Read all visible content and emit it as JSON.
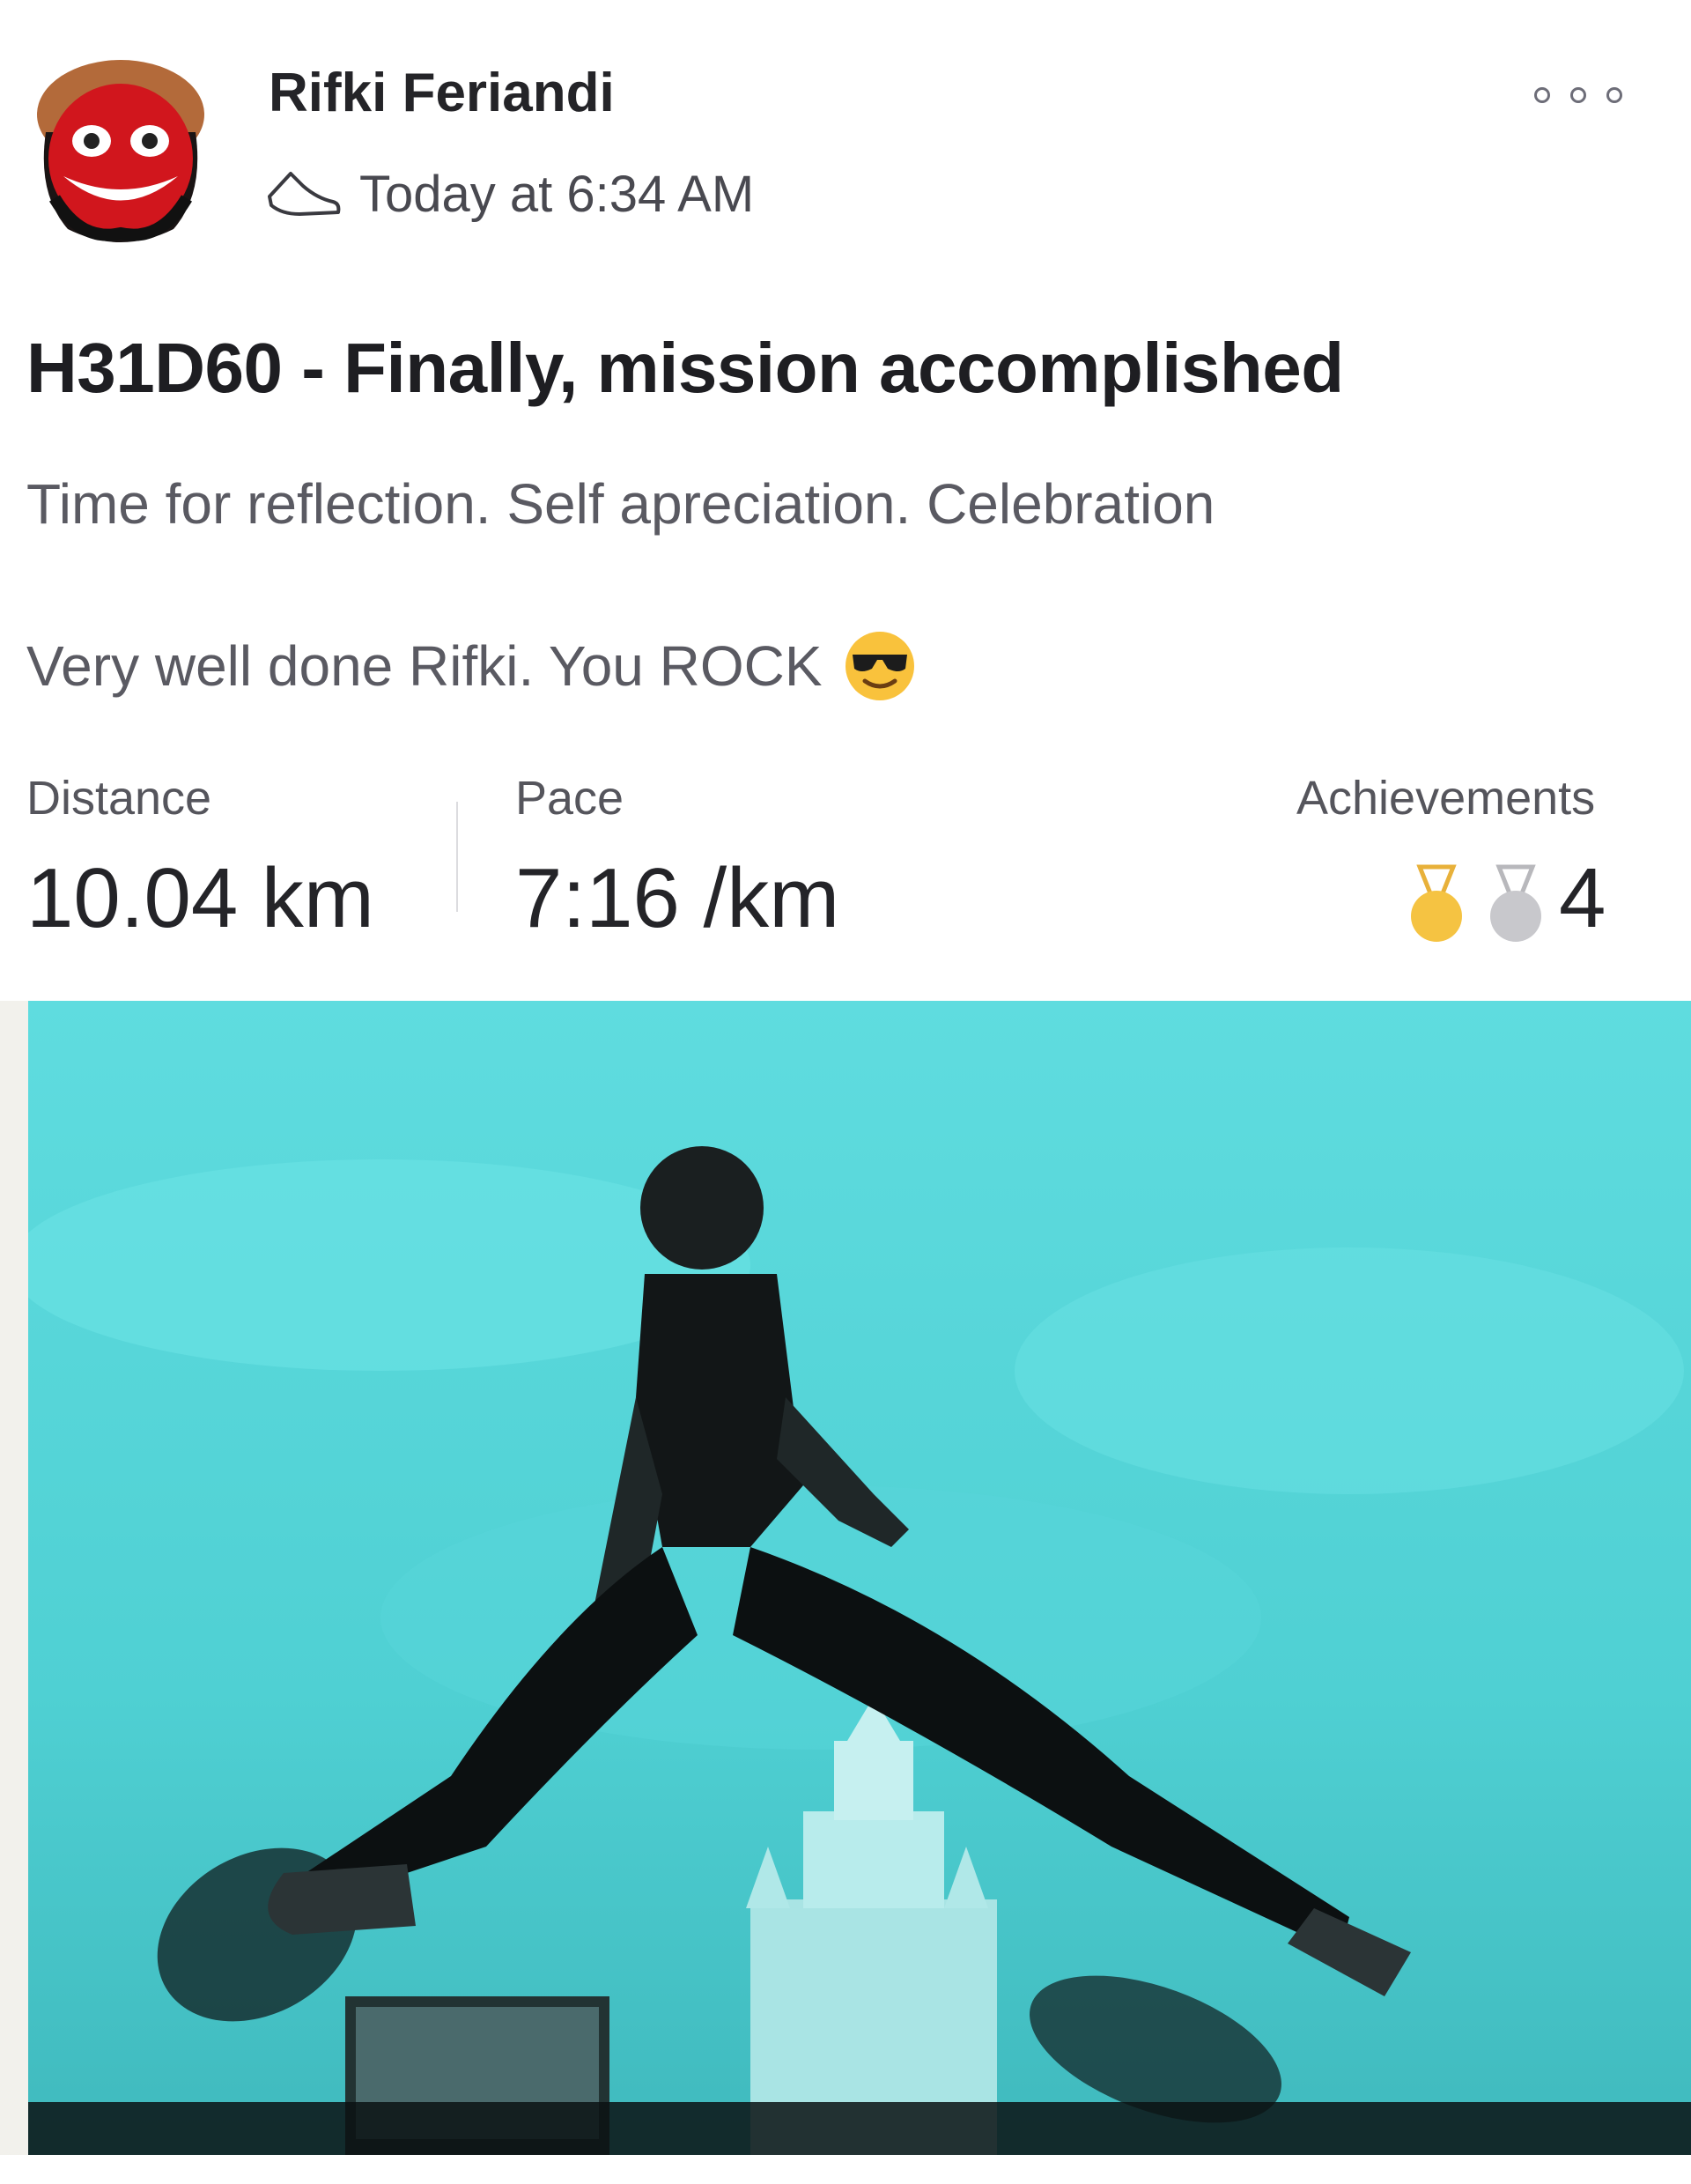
{
  "post": {
    "author_name": "Rifki Feriandi",
    "timestamp": "Today at 6:34 AM",
    "activity_icon": "shoe-icon",
    "title": "H31D60 - Finally, mission accomplished",
    "description_line1": "Time for reflection. Self apreciation. Celebration",
    "description_line2": "Very well done Rifki. You ROCK",
    "description_emoji": "sunglasses-emoji"
  },
  "stats": {
    "distance_label": "Distance",
    "distance_value": "10.04 km",
    "pace_label": "Pace",
    "pace_value": "7:16 /km",
    "achievements_label": "Achievements",
    "achievements_count": "4"
  },
  "icons": {
    "more": "more-options-icon",
    "gold_medal": "gold-medal-icon",
    "silver_medal": "silver-medal-icon"
  },
  "colors": {
    "photo_tint": "#4fd3d6",
    "gold": "#f5c342",
    "silver": "#c8c8cc"
  }
}
